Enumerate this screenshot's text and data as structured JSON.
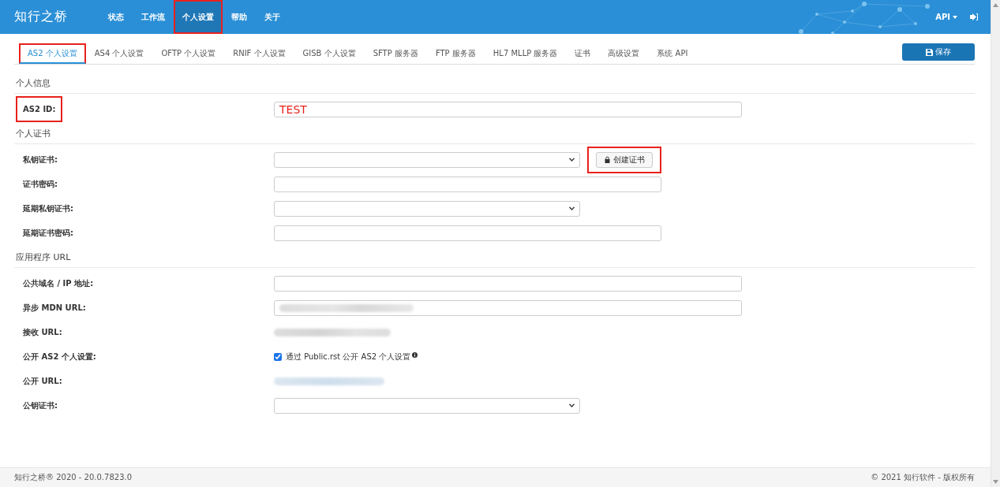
{
  "header": {
    "logo": "知行之桥",
    "nav": [
      {
        "label": "状态",
        "selected": false,
        "highlighted": false
      },
      {
        "label": "工作流",
        "selected": false,
        "highlighted": false
      },
      {
        "label": "个人设置",
        "selected": true,
        "highlighted": true
      },
      {
        "label": "帮助",
        "selected": false,
        "highlighted": false
      },
      {
        "label": "关于",
        "selected": false,
        "highlighted": false
      }
    ],
    "api_menu": "API"
  },
  "tabs": [
    {
      "label": "AS2 个人设置",
      "selected": true,
      "highlighted": true
    },
    {
      "label": "AS4 个人设置",
      "selected": false,
      "highlighted": false
    },
    {
      "label": "OFTP 个人设置",
      "selected": false,
      "highlighted": false
    },
    {
      "label": "RNIF 个人设置",
      "selected": false,
      "highlighted": false
    },
    {
      "label": "GISB 个人设置",
      "selected": false,
      "highlighted": false
    },
    {
      "label": "SFTP 服务器",
      "selected": false,
      "highlighted": false
    },
    {
      "label": "FTP 服务器",
      "selected": false,
      "highlighted": false
    },
    {
      "label": "HL7 MLLP 服务器",
      "selected": false,
      "highlighted": false
    },
    {
      "label": "证书",
      "selected": false,
      "highlighted": false
    },
    {
      "label": "高级设置",
      "selected": false,
      "highlighted": false
    },
    {
      "label": "系统 API",
      "selected": false,
      "highlighted": false
    }
  ],
  "save_button": "保存",
  "sections": [
    {
      "title": "个人信息",
      "rows": [
        {
          "label": "AS2 ID:",
          "kind": "text",
          "value": "TEST",
          "highlighted": true
        }
      ]
    },
    {
      "title": "个人证书",
      "rows": [
        {
          "label": "私钥证书:",
          "kind": "select",
          "button": {
            "label": "创建证书",
            "highlighted": true
          },
          "highlighted": false
        },
        {
          "label": "证书密码:",
          "kind": "password",
          "highlighted": false
        },
        {
          "label": "延期私钥证书:",
          "kind": "select",
          "highlighted": false
        },
        {
          "label": "延期证书密码:",
          "kind": "password",
          "highlighted": false
        }
      ]
    },
    {
      "title": "应用程序 URL",
      "rows": [
        {
          "label": "公共域名 / IP 地址:",
          "kind": "text",
          "highlighted": false
        },
        {
          "label": "异步 MDN URL:",
          "kind": "redacted-field",
          "highlighted": false
        },
        {
          "label": "接收 URL:",
          "kind": "redacted-text",
          "highlighted": false
        },
        {
          "label": "公开 AS2 个人设置:",
          "kind": "checkbox",
          "checked": true,
          "text": "通过 Public.rst 公开 AS2 个人设置",
          "highlighted": false
        },
        {
          "label": "公开 URL:",
          "kind": "redacted-link",
          "highlighted": false
        },
        {
          "label": "公钥证书:",
          "kind": "select",
          "highlighted": false
        }
      ]
    }
  ],
  "footer": {
    "left": "知行之桥® 2020 - 20.0.7823.0",
    "right": "© 2021 知行软件 - 版权所有"
  }
}
